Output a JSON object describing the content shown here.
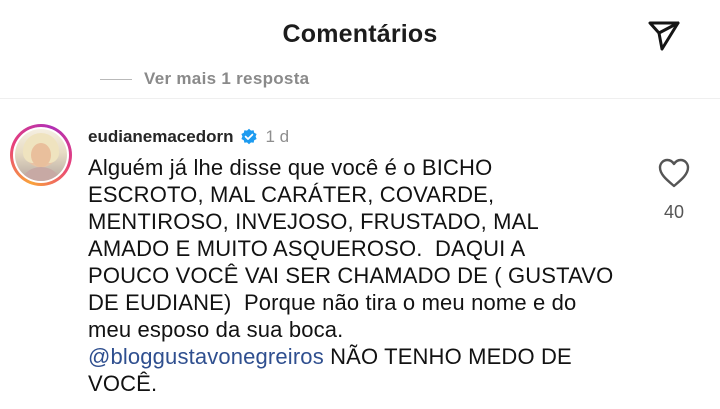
{
  "header": {
    "title": "Comentários",
    "send_icon": "paper-plane-icon"
  },
  "thread": {
    "more_replies": "Ver mais 1 resposta"
  },
  "comment": {
    "username": "eudianemacedorn",
    "verified_icon": "verified-badge-icon",
    "time": "1 d",
    "text_lines": [
      "Alguém já lhe disse que você é o BICHO",
      "ESCROTO, MAL CARÁTER, COVARDE,",
      "MENTIROSO, INVEJOSO, FRUSTADO, MAL",
      "AMADO E MUITO ASQUEROSO.  DAQUI A",
      "POUCO VOCÊ VAI SER CHAMADO DE ( GUSTAVO",
      "DE EUDIANE)  Porque não tira o meu nome e do",
      "meu esposo da sua boca."
    ],
    "mention": "@bloggustavonegreiros",
    "after_mention": " NÃO TENHO MEDO DE",
    "last_line": "VOCÊ.",
    "likes": "40",
    "like_icon": "heart-outline-icon"
  },
  "colors": {
    "mention": "#2f4f8f",
    "verified": "#1d9bf0",
    "secondary_text": "#8e8e8e"
  }
}
